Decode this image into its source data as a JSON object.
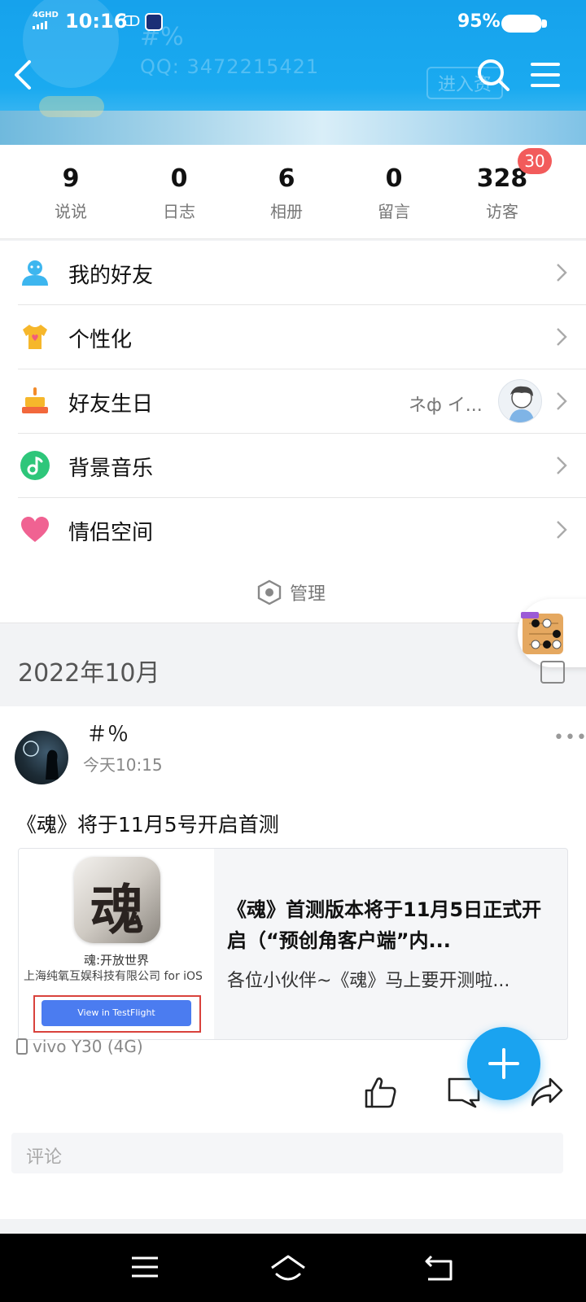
{
  "status_bar": {
    "network": "4GHD",
    "time": "10:16",
    "battery_text": "95%"
  },
  "header": {
    "ghost_name": "#%",
    "ghost_qq": "QQ: 3472215421",
    "ghost_enter": "进入资"
  },
  "stats": [
    {
      "value": "9",
      "label": "说说"
    },
    {
      "value": "0",
      "label": "日志"
    },
    {
      "value": "6",
      "label": "相册"
    },
    {
      "value": "0",
      "label": "留言"
    },
    {
      "value": "328",
      "label": "访客"
    }
  ],
  "visitor_badge": "30",
  "menu": [
    {
      "label": "我的好友",
      "icon": "friends-icon",
      "extra": ""
    },
    {
      "label": "个性化",
      "icon": "shirt-icon",
      "extra": ""
    },
    {
      "label": "好友生日",
      "icon": "cake-icon",
      "extra": "ネф イ..."
    },
    {
      "label": "背景音乐",
      "icon": "music-icon",
      "extra": ""
    },
    {
      "label": "情侣空间",
      "icon": "heart-icon",
      "extra": ""
    }
  ],
  "manage_label": "管理",
  "month_label": "2022年10月",
  "post": {
    "author": "＃％",
    "time": "今天10:15",
    "text": "《魂》将于11月5号开启首测",
    "link": {
      "icon_char": "魂",
      "thumb_name": "魂:开放世界",
      "thumb_company": "上海纯氧互娱科技有限公司 for iOS",
      "thumb_button": "View in TestFlight",
      "title": "《魂》首测版本将于11月5日正式开启（“预创角客户端”内...",
      "desc": "各位小伙伴~《魂》马上要开测啦..."
    },
    "device": "vivo Y30 (4G)",
    "comment_placeholder": "评论"
  },
  "colors": {
    "brand_blue": "#1aa3f0",
    "badge_red": "#f25b5b"
  }
}
